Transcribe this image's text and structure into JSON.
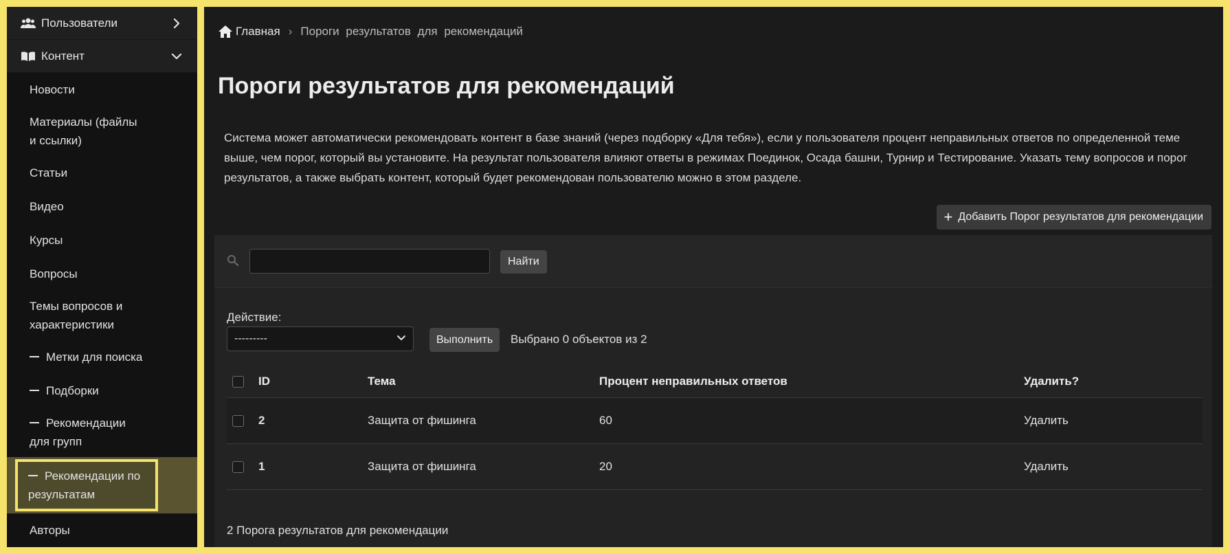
{
  "sidebar": {
    "groups": [
      {
        "label": "Пользователи",
        "icon": "users-icon",
        "state": "collapsed"
      },
      {
        "label": "Контент",
        "icon": "book-icon",
        "state": "expanded"
      }
    ],
    "items": [
      {
        "label": "Новости"
      },
      {
        "label": "Материалы (файлы и ссылки)"
      },
      {
        "label": "Статьи"
      },
      {
        "label": "Видео"
      },
      {
        "label": "Курсы"
      },
      {
        "label": "Вопросы"
      },
      {
        "label": "Темы вопросов и характеристики"
      },
      {
        "label": "Метки для поиска"
      },
      {
        "label": "Подборки"
      },
      {
        "label": "Рекомендации для групп"
      },
      {
        "label": "Рекомендации по результатам"
      },
      {
        "label": "Авторы"
      }
    ]
  },
  "breadcrumb": {
    "home": "Главная",
    "separator": "›",
    "current": "Пороги результатов для рекомендаций"
  },
  "page": {
    "title": "Пороги результатов для рекомендаций",
    "description": "Система может автоматически рекомендовать контент в базе знаний (через подборку «Для тебя»), если у пользователя процент неправильных ответов по определенной теме выше, чем порог, который вы установите. На результат пользователя влияют ответы в режимах Поединок, Осада башни, Турнир и Тестирование. Указать тему вопросов и порог результатов, а также выбрать контент, который будет рекомендован пользователю можно в этом разделе.",
    "add_button": "Добавить Порог результатов для рекомендации"
  },
  "search": {
    "value": "",
    "button": "Найти"
  },
  "actions": {
    "label": "Действие:",
    "selected": "---------",
    "run_button": "Выполнить",
    "selected_count": "Выбрано 0 объектов из 2"
  },
  "table": {
    "headers": [
      "ID",
      "Тема",
      "Процент неправильных ответов",
      "Удалить?"
    ],
    "rows": [
      {
        "id": "2",
        "topic": "Защита от фишинга",
        "percent": "60",
        "delete": "Удалить"
      },
      {
        "id": "1",
        "topic": "Защита от фишинга",
        "percent": "20",
        "delete": "Удалить"
      }
    ]
  },
  "footer": {
    "count": "2 Порога результатов для рекомендации"
  },
  "colors": {
    "frame": "#f6e36b",
    "sidebar_bg": "#121212",
    "main_bg": "#1b1b1b",
    "active_item_bg": "#4e4a2c"
  }
}
